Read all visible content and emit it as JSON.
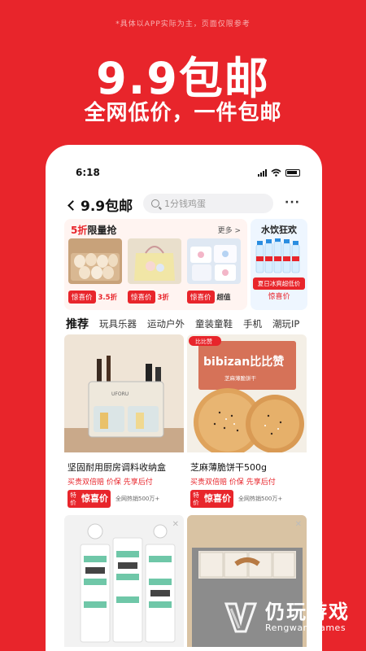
{
  "promo": {
    "note": "*具体以APP实际为主，页面仅限参考",
    "title": "9.9包邮",
    "subtitle": "全网低价，一件包邮"
  },
  "status": {
    "time": "6:18"
  },
  "nav": {
    "back_label": "9.9包邮",
    "search_placeholder": "1分钱鸡蛋",
    "more_label": "···"
  },
  "flash_sale": {
    "title_red": "5折",
    "title_rest": "限量抢",
    "more_label": "更多 >",
    "items": [
      {
        "tag": "惊喜价",
        "price": "3.5折"
      },
      {
        "tag": "惊喜价",
        "price": "3折"
      },
      {
        "tag": "惊喜价",
        "price": "超值"
      }
    ]
  },
  "water": {
    "title": "水饮狂欢",
    "tag": "夏日冰爽超低价",
    "label": "惊喜价"
  },
  "tabs": [
    "推荐",
    "玩具乐器",
    "运动户外",
    "童装童鞋",
    "手机",
    "潮玩IP"
  ],
  "products": [
    {
      "title": "坚固耐用厨房调料收纳盒",
      "badges": "买贵双倍赔  价保  先享后付",
      "special": "特价",
      "price_label": "惊喜价",
      "sold": "全网热销500万+",
      "brand": "UFORU"
    },
    {
      "title": "芝麻薄脆饼干500g",
      "badges": "买贵双倍赔  价保  先享后付",
      "special": "特价",
      "price_label": "惊喜价",
      "sold": "全网热销500万+",
      "brand": "bibizan比比赞",
      "logo": "比比赞",
      "box_sub": "芝麻薄脆饼干"
    }
  ],
  "watermark": {
    "cn": "仍玩游戏",
    "en": "Rengwan Games"
  },
  "colors": {
    "accent": "#e8252b",
    "background": "#e8252b"
  }
}
